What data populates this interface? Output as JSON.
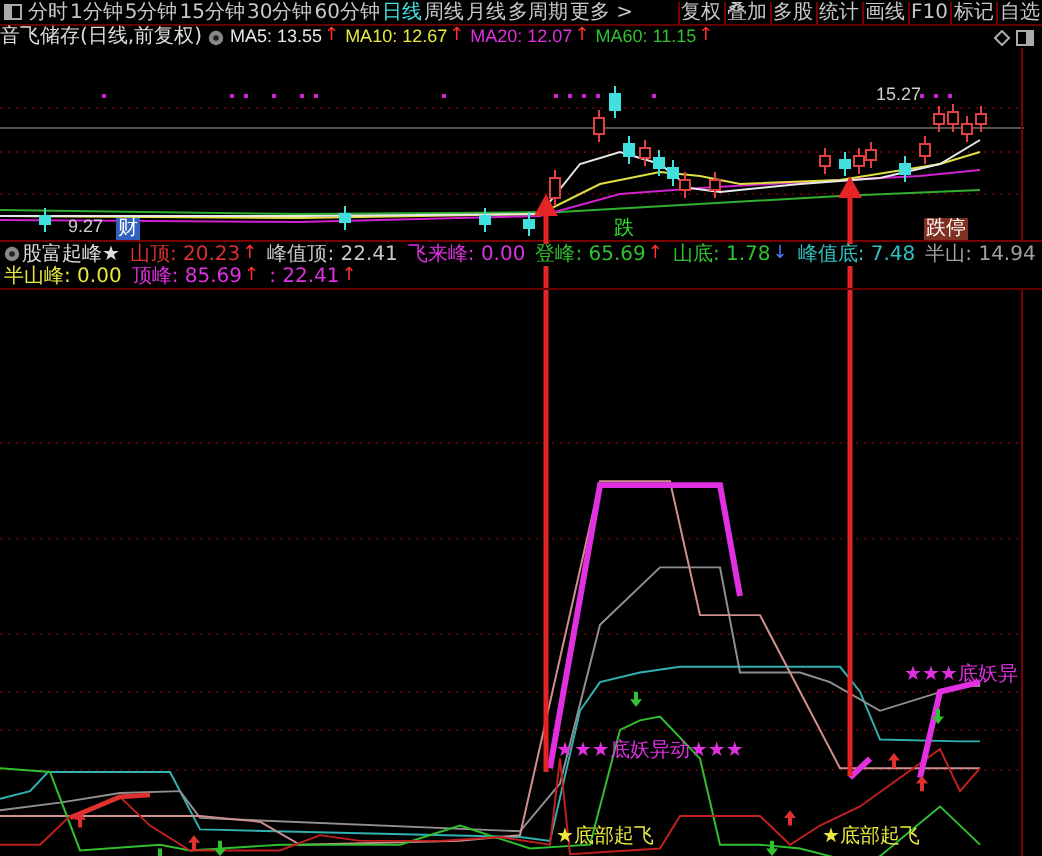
{
  "toolbar": {
    "periods": [
      {
        "label": "分时",
        "selected": false
      },
      {
        "label": "1分钟",
        "selected": false
      },
      {
        "label": "5分钟",
        "selected": false
      },
      {
        "label": "15分钟",
        "selected": false
      },
      {
        "label": "30分钟",
        "selected": false
      },
      {
        "label": "60分钟",
        "selected": false
      },
      {
        "label": "日线",
        "selected": true
      },
      {
        "label": "周线",
        "selected": false
      },
      {
        "label": "月线",
        "selected": false
      },
      {
        "label": "多周期",
        "selected": false
      },
      {
        "label": "更多 >",
        "selected": false
      }
    ],
    "buttons": [
      "复权",
      "叠加",
      "多股",
      "统计",
      "画线",
      "F10",
      "标记",
      "自选"
    ]
  },
  "header": {
    "title": "音飞储存(日线,前复权)",
    "averages": [
      {
        "label": "MA5: 13.55",
        "color": "#e8e8e8",
        "arrow": "↑"
      },
      {
        "label": "MA10: 12.67",
        "color": "#e8e840",
        "arrow": "↑"
      },
      {
        "label": "MA20: 12.07",
        "color": "#e030e0",
        "arrow": "↑"
      },
      {
        "label": "MA60: 11.15",
        "color": "#30c030",
        "arrow": "↑"
      }
    ]
  },
  "price_chart": {
    "high_label": "15.27",
    "low_label": "9.27",
    "markers": [
      {
        "text": "财",
        "kind": "finance"
      },
      {
        "text": "跌",
        "kind": "fall"
      },
      {
        "text": "跌停",
        "kind": "limit"
      }
    ]
  },
  "indicator": {
    "title": "股富起峰★",
    "values": [
      {
        "label": "山顶: 20.23",
        "color": "#e03030",
        "arrow": "↑"
      },
      {
        "label": "峰值顶: 22.41",
        "color": "#c8c8c8"
      },
      {
        "label": "飞来峰: 0.00",
        "color": "#e030e0"
      },
      {
        "label": "登峰: 65.69",
        "color": "#30c030",
        "arrow": "↑"
      },
      {
        "label": "山底: 1.78",
        "color": "#30c030",
        "arrow": "↓"
      },
      {
        "label": "峰值底: 7.48",
        "color": "#30c0c0"
      },
      {
        "label": "半山: 14.94",
        "color": "#a0a0a0"
      },
      {
        "label": "半山峰: 0.00",
        "color": "#e8e840"
      },
      {
        "label": "顶峰: 85.69",
        "color": "#e030e0",
        "arrow": "↑"
      },
      {
        "label": ": 22.41",
        "color": "#e030e0",
        "arrow": "↑"
      }
    ],
    "annotations": [
      {
        "text": "★★★底妖异动★★★",
        "kind": "anomaly"
      },
      {
        "text": "★★★底妖异",
        "kind": "anomaly"
      },
      {
        "text": "★底部起飞",
        "kind": "takeoff"
      },
      {
        "text": "★底部起飞",
        "kind": "takeoff"
      }
    ]
  }
}
